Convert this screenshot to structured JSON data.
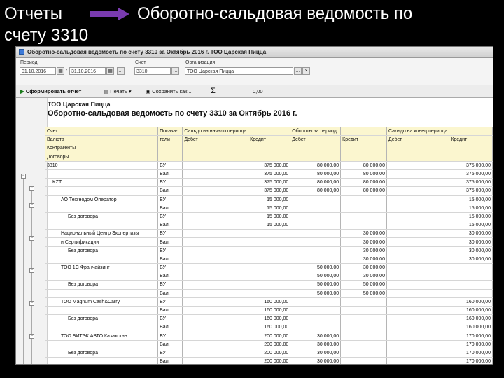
{
  "slide": {
    "title_left_line1": "Отчеты",
    "title_left_line2": "счету 3310",
    "title_right": "Оборотно-сальдовая ведомость по"
  },
  "colors": {
    "arrow": "#7a3bb0",
    "header_bg": "#fbf6cf"
  },
  "window": {
    "title": "Оборотно-сальдовая ведомость по счету 3310 за Октябрь 2016 г. ТОО Царская Пицца"
  },
  "params": {
    "period_label": "Период",
    "period_from": "01.10.2016",
    "period_to": "31.10.2016",
    "account_label": "Счет",
    "account_value": "3310",
    "org_label": "Организация",
    "org_value": "ТОО Царская Пицца",
    "picker_icon": "ellipsis-icon",
    "calendar_icon": "calendar-icon"
  },
  "toolbar": {
    "generate_label": "Сформировать отчет",
    "print_label": "Печать",
    "save_label": "Сохранить как...",
    "sum_symbol": "Σ",
    "sum_value": "0,00"
  },
  "report": {
    "org_name": "ТОО Царская Пицца",
    "title": "Оборотно-сальдовая ведомость по счету 3310 за Октябрь 2016 г.",
    "header_rows": [
      [
        "Счет",
        "Показа-",
        "Сальдо на начало периода",
        "",
        "Обороты за период",
        "",
        "Сальдо на конец периода",
        ""
      ],
      [
        "Валюта",
        "тели",
        "Дебет",
        "Кредит",
        "Дебет",
        "Кредит",
        "Дебет",
        "Кредит"
      ],
      [
        "Контрагенты",
        "",
        "",
        "",
        "",
        "",
        "",
        ""
      ],
      [
        "Договоры",
        "",
        "",
        "",
        "",
        "",
        "",
        ""
      ]
    ],
    "rows": [
      [
        "3310",
        "БУ",
        "",
        "375 000,00",
        "80 000,00",
        "80 000,00",
        "",
        "375 000,00"
      ],
      [
        "",
        "Вал.",
        "",
        "375 000,00",
        "80 000,00",
        "80 000,00",
        "",
        "375 000,00"
      ],
      [
        "KZT",
        "БУ",
        "",
        "375 000,00",
        "80 000,00",
        "80 000,00",
        "",
        "375 000,00"
      ],
      [
        "",
        "Вал.",
        "",
        "375 000,00",
        "80 000,00",
        "80 000,00",
        "",
        "375 000,00"
      ],
      [
        "АО Техгнодом Оператор",
        "БУ",
        "",
        "15 000,00",
        "",
        "",
        "",
        "15 000,00"
      ],
      [
        "",
        "Вал.",
        "",
        "15 000,00",
        "",
        "",
        "",
        "15 000,00"
      ],
      [
        "Без договора",
        "БУ",
        "",
        "15 000,00",
        "",
        "",
        "",
        "15 000,00"
      ],
      [
        "",
        "Вал.",
        "",
        "15 000,00",
        "",
        "",
        "",
        "15 000,00"
      ],
      [
        "Национальный Центр Экспертизы",
        "БУ",
        "",
        "",
        "",
        "30 000,00",
        "",
        "30 000,00"
      ],
      [
        "и Сертификации",
        "Вал.",
        "",
        "",
        "",
        "30 000,00",
        "",
        "30 000,00"
      ],
      [
        "Без договора",
        "БУ",
        "",
        "",
        "",
        "30 000,00",
        "",
        "30 000,00"
      ],
      [
        "",
        "Вал.",
        "",
        "",
        "",
        "30 000,00",
        "",
        "30 000,00"
      ],
      [
        "ТОО 1С Франчайзинг",
        "БУ",
        "",
        "",
        "50 000,00",
        "30 000,00",
        "",
        ""
      ],
      [
        "",
        "Вал.",
        "",
        "",
        "50 000,00",
        "30 000,00",
        "",
        ""
      ],
      [
        "Без договора",
        "БУ",
        "",
        "",
        "50 000,00",
        "50 000,00",
        "",
        ""
      ],
      [
        "",
        "Вал.",
        "",
        "",
        "50 000,00",
        "50 000,00",
        "",
        ""
      ],
      [
        "ТОО Magnum Cash&Carry",
        "БУ",
        "",
        "160 000,00",
        "",
        "",
        "",
        "160 000,00"
      ],
      [
        "",
        "Вал.",
        "",
        "160 000,00",
        "",
        "",
        "",
        "160 000,00"
      ],
      [
        "Без договора",
        "БУ",
        "",
        "160 000,00",
        "",
        "",
        "",
        "160 000,00"
      ],
      [
        "",
        "Вал.",
        "",
        "160 000,00",
        "",
        "",
        "",
        "160 000,00"
      ],
      [
        "ТОО БИТЭК АВТО Казахстан",
        "БУ",
        "",
        "200 000,00",
        "30 000,00",
        "",
        "",
        "170 000,00"
      ],
      [
        "",
        "Вал.",
        "",
        "200 000,00",
        "30 000,00",
        "",
        "",
        "170 000,00"
      ],
      [
        "Без договора",
        "БУ",
        "",
        "200 000,00",
        "30 000,00",
        "",
        "",
        "170 000,00"
      ],
      [
        "",
        "Вал.",
        "",
        "200 000,00",
        "30 000,00",
        "",
        "",
        "170 000,00"
      ]
    ]
  }
}
